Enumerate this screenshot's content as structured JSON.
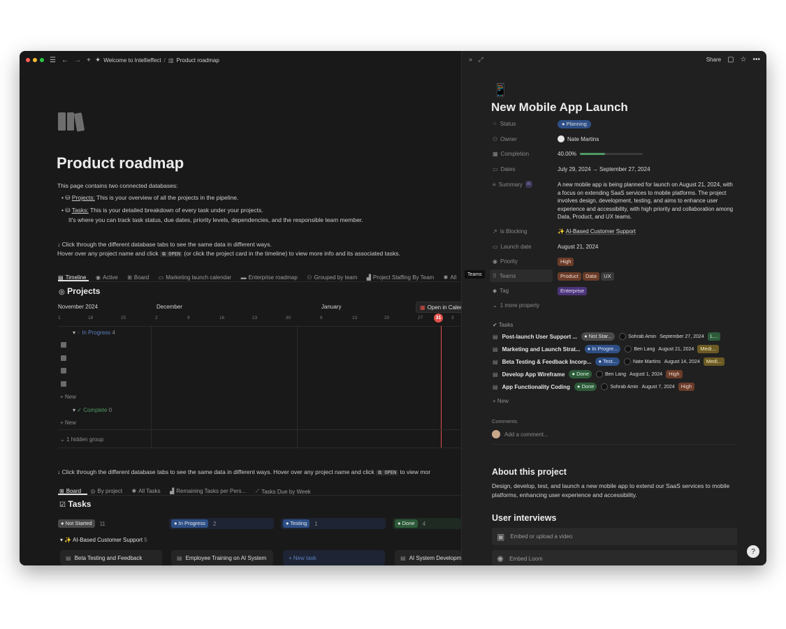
{
  "topbar": {
    "breadcrumb_1": "Welcome to Intellieffect",
    "breadcrumb_sep": "/",
    "breadcrumb_2": "Product roadmap"
  },
  "page": {
    "title": "Product roadmap",
    "intro": "This page contains two connected databases:",
    "bullet_1_label": "Projects:",
    "bullet_1_text": " This is your overview of all the projects in the pipeline.",
    "bullet_2_label": "Tasks:",
    "bullet_2_text": " This is your detailed breakdown of every task under your projects.",
    "bullet_2_line2": "It's where you can track task status, due dates, priority levels, dependencies, and the responsible team member.",
    "hint_1": "↓ Click through the different database tabs to see the same data in different ways.",
    "hint_2a": "Hover over any project name and click",
    "hint_2_code": "OPEN",
    "hint_2b": "(or click the project card in the timeline) to view more info and its associated tasks.",
    "hint_3": "↓ Click through the different database tabs to see the same data in different ways. Hover over any project name and click",
    "hint_3_code": "OPEN",
    "hint_3b": "to view mor"
  },
  "projects_tabs": [
    "Timeline",
    "Active",
    "Board",
    "Marketing launch calendar",
    "Enterprise roadmap",
    "Grouped by team",
    "Project Staffing By Team",
    "All"
  ],
  "projects": {
    "title": "Projects",
    "open_in_calendar": "Open in Caler",
    "months": [
      "November 2024",
      "December",
      "January"
    ],
    "days": [
      "1",
      "18",
      "25",
      "2",
      "9",
      "16",
      "23",
      "30",
      "6",
      "13",
      "20",
      "27",
      "31",
      "3"
    ],
    "group_in_progress": "In Progress",
    "group_in_progress_count": "4",
    "group_complete": "Complete",
    "group_complete_count": "0",
    "new_label": "+ New",
    "hidden_group": "1 hidden group"
  },
  "tasks_tabs": [
    "Board",
    "By project",
    "All Tasks",
    "Remaining Tasks per Pers...",
    "Tasks Due by Week"
  ],
  "tasks_board": {
    "title": "Tasks",
    "columns": [
      {
        "label": "Not Started",
        "count": "11"
      },
      {
        "label": "In Progress",
        "count": "2"
      },
      {
        "label": "Testing",
        "count": "1"
      },
      {
        "label": "Done",
        "count": "4"
      }
    ],
    "group_label": "AI-Based Customer Support",
    "group_count": "5",
    "cards": [
      "Beta Testing and Feedback",
      "Employee Training on AI System",
      "+ New task",
      "AI System Developm"
    ]
  },
  "detail": {
    "share": "Share",
    "emoji": "📱",
    "title": "New Mobile App Launch",
    "props": {
      "status_label": "Status",
      "status_value": "Planning",
      "owner_label": "Owner",
      "owner_value": "Nate Martins",
      "completion_label": "Completion",
      "completion_value": "40.00%",
      "completion_fraction": 0.4,
      "dates_label": "Dates",
      "dates_value": "July 29, 2024 → September 27, 2024",
      "summary_label": "Summary",
      "summary_ai": "AI",
      "summary_value": "A new mobile app is being planned for launch on August 21, 2024, with a focus on extending SaaS services to mobile platforms. The project involves design, development, testing, and aims to enhance user experience and accessibility, with high priority and collaboration among Data, Product, and UX teams.",
      "blocking_label": "Is Blocking",
      "blocking_value": "AI-Based Customer Support",
      "launch_label": "Launch date",
      "launch_value": "August 21, 2024",
      "priority_label": "Priority",
      "priority_value": "High",
      "teams_label": "Teams",
      "teams_tooltip": "Teams",
      "teams_values": [
        "Product",
        "Data",
        "UX"
      ],
      "tag_label": "Tag",
      "tag_value": "Enterprise",
      "more_label": "1 more property"
    },
    "tasks_label": "Tasks",
    "tasks": [
      {
        "name": "Post-launch User Support ...",
        "status": "Not Star...",
        "person": "Sohrab Amin",
        "date": "September 27, 2024",
        "prio": "L..."
      },
      {
        "name": "Marketing and Launch Strat...",
        "status": "In Progre...",
        "person": "Ben Lang",
        "date": "August 21, 2024",
        "prio": "Medi..."
      },
      {
        "name": "Beta Testing & Feedback Incorp...",
        "status": "Test...",
        "person": "Nate Martins",
        "date": "August 14, 2024",
        "prio": "Medi..."
      },
      {
        "name": "Develop App Wireframe",
        "status": "Done",
        "person": "Ben Lang",
        "date": "August 1, 2024",
        "prio": "High"
      },
      {
        "name": "App Functionality Coding",
        "status": "Done",
        "person": "Sohrab Amin",
        "date": "August 7, 2024",
        "prio": "High"
      }
    ],
    "tasks_new": "+ New",
    "comments_label": "Comments",
    "comment_placeholder": "Add a comment...",
    "about_title": "About this project",
    "about_text": "Design, develop, test, and launch a new mobile app to extend our SaaS services to mobile platforms, enhancing user experience and accessibility.",
    "interviews_title": "User interviews",
    "embed_video": "Embed or upload a video",
    "embed_loom": "Embed Loom"
  },
  "colors": {
    "bg": "#191919",
    "panel": "#202020",
    "blue": "#2e4f86",
    "red": "#e0504a",
    "green": "#2d5b3a",
    "brown": "#6b3c2a",
    "purple": "#4b3579"
  }
}
